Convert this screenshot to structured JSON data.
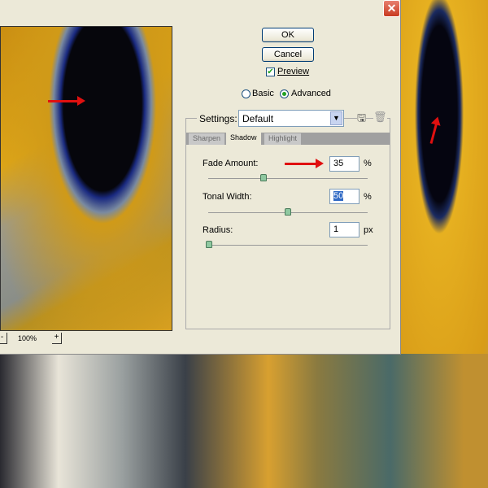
{
  "dialog": {
    "close_label": "✕"
  },
  "buttons": {
    "ok": "OK",
    "cancel": "Cancel"
  },
  "preview": {
    "label": "Preview",
    "checked": true
  },
  "mode": {
    "basic": "Basic",
    "advanced": "Advanced",
    "selected": "Advanced"
  },
  "settings": {
    "label": "Settings:",
    "value": "Default"
  },
  "tabs": [
    {
      "label": "Sharpen"
    },
    {
      "label": "Shadow"
    },
    {
      "label": "Highlight"
    }
  ],
  "active_tab": "Shadow",
  "fade": {
    "label": "Fade Amount:",
    "value": "35",
    "unit": "%"
  },
  "tonal": {
    "label": "Tonal Width:",
    "value": "50",
    "unit": "%"
  },
  "radius": {
    "label": "Radius:",
    "value": "1",
    "unit": "px"
  },
  "zoom": {
    "value": "100%",
    "minus": "-",
    "plus": "+"
  },
  "colors": {
    "annotation_arrow": "#e01010"
  }
}
